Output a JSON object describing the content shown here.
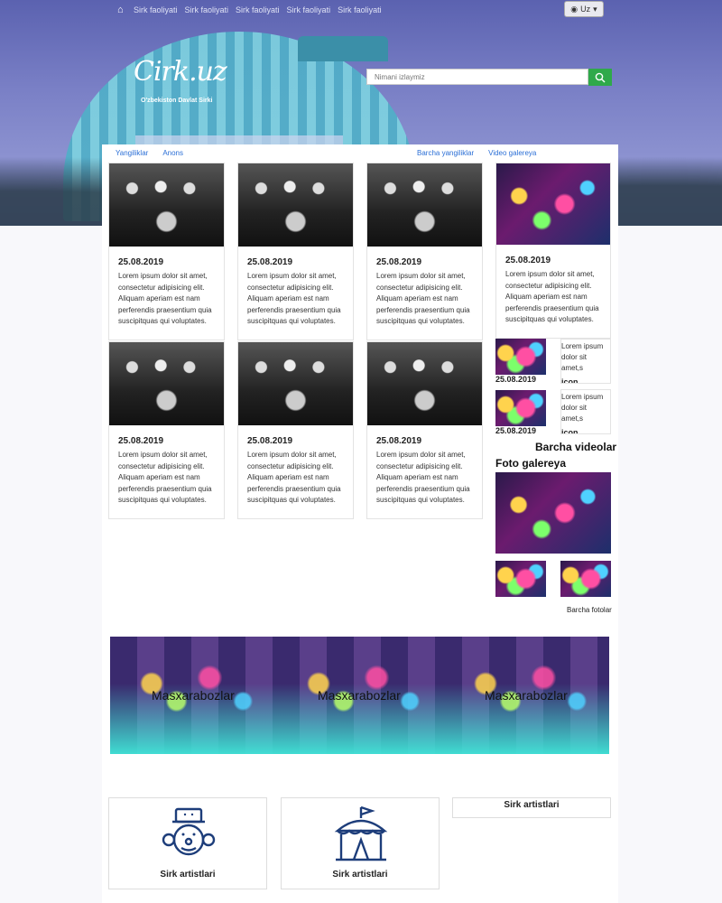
{
  "topnav": {
    "items": [
      "Sirk faoliyati",
      "Sirk faoliyati",
      "Sirk faoliyati",
      "Sirk faoliyati",
      "Sirk faoliyati"
    ],
    "lang": "Uz"
  },
  "brand": {
    "logo": "Cirk.uz",
    "subtitle": "O'zbekiston Davlat Sirki"
  },
  "search": {
    "placeholder": "Nimani izlaymiz"
  },
  "tabs": {
    "left": [
      "Yangiliklar",
      "Anons"
    ],
    "right": [
      "Barcha yangiliklar",
      "Video galereya"
    ]
  },
  "news": [
    {
      "date": "25.08.2019",
      "text": "Lorem ipsum dolor sit amet, consectetur adipisicing elit. Aliquam aperiam est nam perferendis praesentium quia suscipitquas qui voluptates."
    },
    {
      "date": "25.08.2019",
      "text": "Lorem ipsum dolor sit amet, consectetur adipisicing elit. Aliquam aperiam est nam perferendis praesentium quia suscipitquas qui voluptates."
    },
    {
      "date": "25.08.2019",
      "text": "Lorem ipsum dolor sit amet, consectetur adipisicing elit. Aliquam aperiam est nam perferendis praesentium quia suscipitquas qui voluptates."
    },
    {
      "date": "25.08.2019",
      "text": "Lorem ipsum dolor sit amet, consectetur adipisicing elit. Aliquam aperiam est nam perferendis praesentium quia suscipitquas qui voluptates."
    },
    {
      "date": "25.08.2019",
      "text": "Lorem ipsum dolor sit amet, consectetur adipisicing elit. Aliquam aperiam est nam perferendis praesentium quia suscipitquas qui voluptates."
    },
    {
      "date": "25.08.2019",
      "text": "Lorem ipsum dolor sit amet, consectetur adipisicing elit. Aliquam aperiam est nam perferendis praesentium quia suscipitquas qui voluptates."
    }
  ],
  "video": {
    "main": {
      "date": "25.08.2019",
      "text": "Lorem ipsum dolor sit amet, consectetur adipisicing elit. Aliquam aperiam est nam perferendis praesentium quia suscipitquas qui voluptates."
    },
    "items": [
      {
        "date": "25.08.2019",
        "text": "Lorem ipsum dolor sit amet,s",
        "icon": "icon"
      },
      {
        "date": "25.08.2019",
        "text": "Lorem ipsum dolor sit amet,s",
        "icon": "icon"
      }
    ],
    "all_label": "Barcha videolar"
  },
  "gallery": {
    "title": "Foto galereya",
    "all_label": "Barcha fotolar"
  },
  "banner": {
    "labels": [
      "Masxarabozlar",
      "Masxarabozlar",
      "Masxarabozlar"
    ]
  },
  "features": [
    "Sirk artistlari",
    "Sirk artistlari",
    "Sirk artistlari"
  ]
}
